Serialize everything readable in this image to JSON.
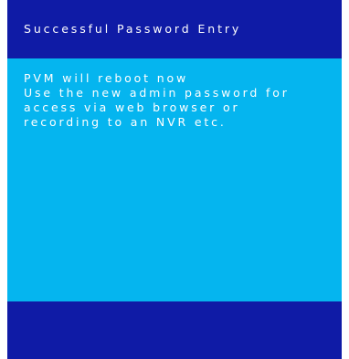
{
  "dialog": {
    "title": "Successful Password Entry",
    "message_lines": [
      "PVM will reboot now",
      "Use the new admin password for",
      "access via web browser or",
      "recording to an NVR etc."
    ]
  },
  "colors": {
    "title_bar": "#0f1ba6",
    "body": "#05b5ef",
    "footer_bar": "#0f1ba6",
    "text": "#ffffff"
  }
}
